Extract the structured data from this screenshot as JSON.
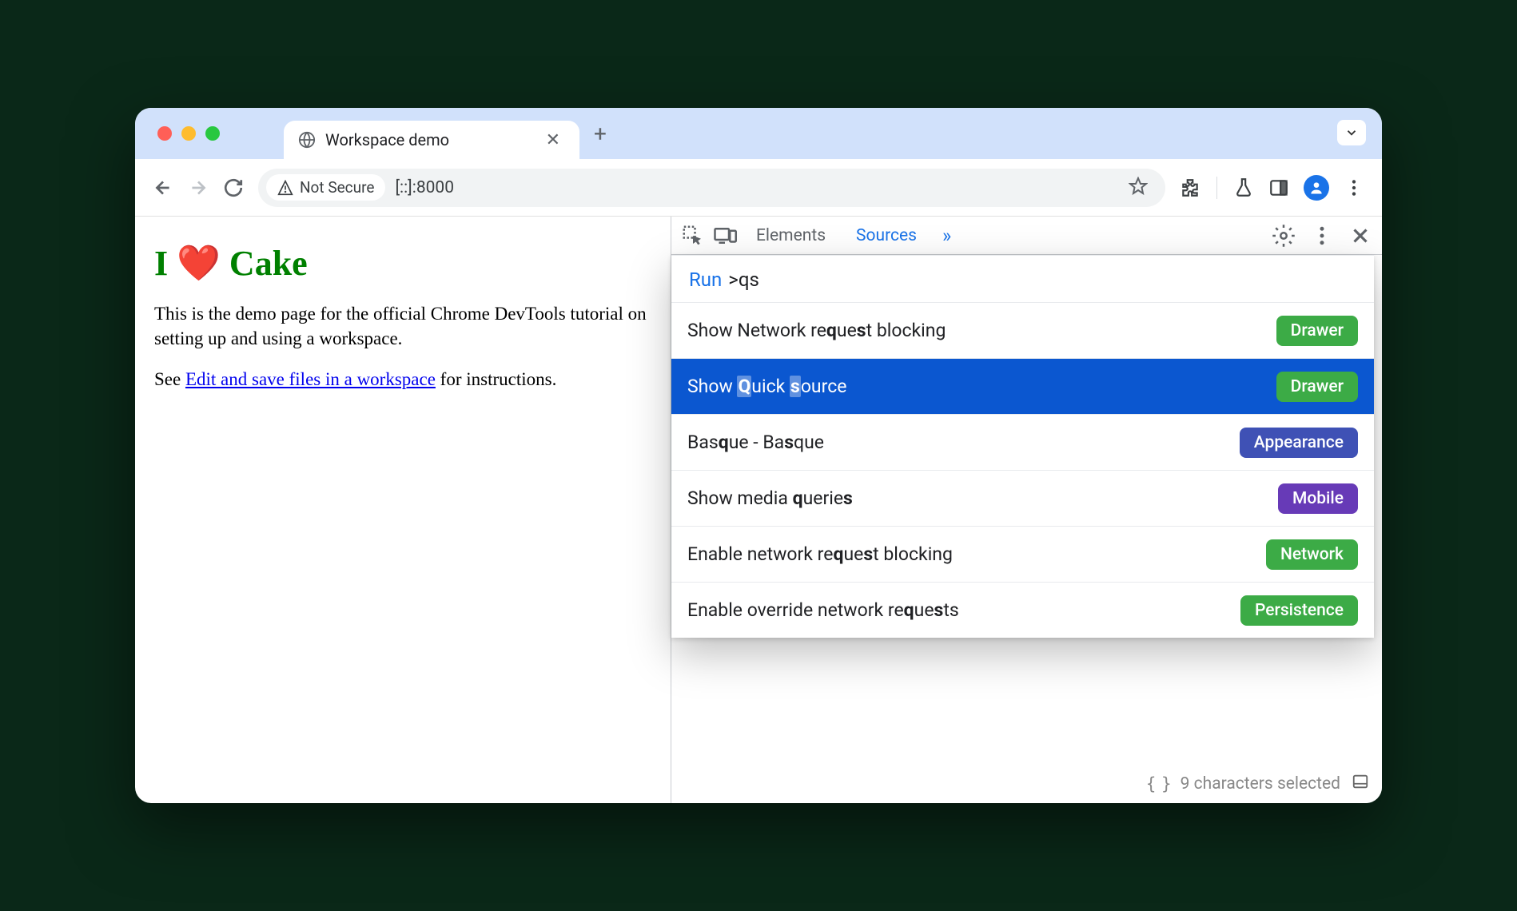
{
  "browser": {
    "tab_title": "Workspace demo",
    "security_chip": "Not Secure",
    "url": "[::]:8000"
  },
  "page": {
    "h1_parts": {
      "i": "I",
      "heart": "❤️",
      "cake": "Cake"
    },
    "p1": "This is the demo page for the official Chrome DevTools tutorial on setting up and using a workspace.",
    "p2_pre": "See ",
    "p2_link": "Edit and save files in a workspace",
    "p2_post": " for instructions."
  },
  "devtools": {
    "tabs": {
      "elements": "Elements",
      "sources": "Sources"
    },
    "command_menu": {
      "run_label": "Run",
      "query": ">qs",
      "items": [
        {
          "pre": "Show Network re",
          "h1": "q",
          "mid1": "ue",
          "h2": "s",
          "mid2": "t blocking",
          "badge": "Drawer",
          "badge_color": "green",
          "selected": false
        },
        {
          "pre": "Show ",
          "h1": "Q",
          "mid1": "uick ",
          "h2": "s",
          "mid2": "ource",
          "badge": "Drawer",
          "badge_color": "green",
          "selected": true
        },
        {
          "pre": "Bas",
          "h1": "q",
          "mid1": "ue - Ba",
          "h2": "s",
          "mid2": "que",
          "badge": "Appearance",
          "badge_color": "blue",
          "selected": false
        },
        {
          "pre": "Show media ",
          "h1": "q",
          "mid1": "uerie",
          "h2": "s",
          "mid2": "",
          "badge": "Mobile",
          "badge_color": "purple",
          "selected": false
        },
        {
          "pre": "Enable network re",
          "h1": "q",
          "mid1": "ue",
          "h2": "s",
          "mid2": "t blocking",
          "badge": "Network",
          "badge_color": "green",
          "selected": false
        },
        {
          "pre": "Enable override network re",
          "h1": "q",
          "mid1": "ue",
          "h2": "s",
          "mid2": "ts",
          "badge": "Persistence",
          "badge_color": "green",
          "selected": false
        }
      ]
    },
    "status": "9 characters selected"
  }
}
